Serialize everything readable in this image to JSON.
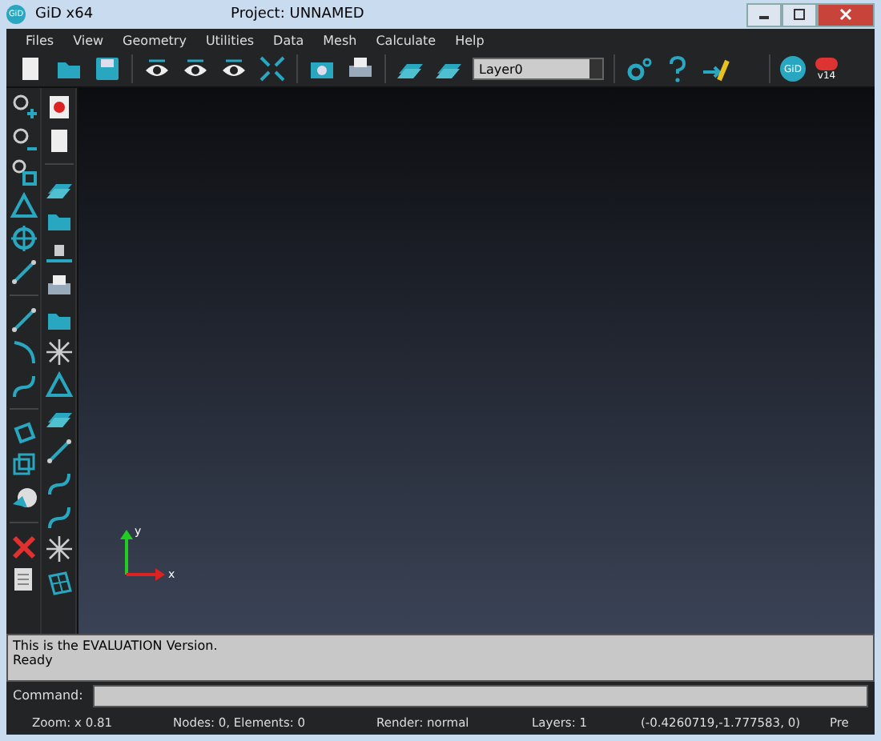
{
  "window": {
    "app_logo": "GiD",
    "title": "GiD x64",
    "project": "Project: UNNAMED"
  },
  "menu": [
    {
      "label": "Files"
    },
    {
      "label": "View"
    },
    {
      "label": "Geometry"
    },
    {
      "label": "Utilities"
    },
    {
      "label": "Data"
    },
    {
      "label": "Mesh"
    },
    {
      "label": "Calculate"
    },
    {
      "label": "Help"
    }
  ],
  "toolbar": {
    "layer": "Layer0",
    "gid_button": "GiD",
    "version": "v14"
  },
  "viewport": {
    "axis_y": "y",
    "axis_x": "x"
  },
  "messages": [
    "This is the EVALUATION Version.",
    "Ready"
  ],
  "command": {
    "label": "Command:"
  },
  "status_bar": [
    "Zoom: x 0.81",
    "Nodes: 0, Elements: 0",
    "Render: normal",
    "Layers: 1",
    "(-0.4260719,-1.777583, 0)",
    "Pre"
  ]
}
